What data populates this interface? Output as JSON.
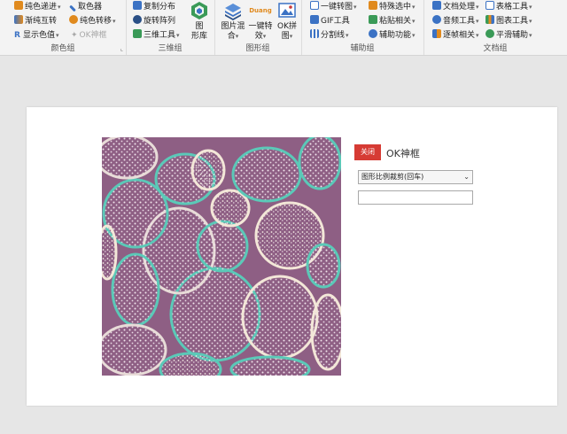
{
  "ribbon": {
    "groups": {
      "color": {
        "label": "颜色组",
        "items": [
          "纯色递进",
          "取色器",
          "渐纯互转",
          "纯色转移",
          "显示色值",
          "OK神框"
        ]
      },
      "three_d": {
        "label": "三维组",
        "items": [
          "复制分布",
          "旋转阵列",
          "三维工具"
        ],
        "big_label_1": "图",
        "big_label_2": "形库"
      },
      "graphics": {
        "label": "图形组",
        "btn1_l1": "图片混",
        "btn1_l2": "合",
        "btn2_top": "Duang",
        "btn2_l1": "一键特",
        "btn2_l2": "效",
        "btn3_l1": "OK拼",
        "btn3_l2": "图"
      },
      "assist": {
        "label": "辅助组",
        "items": [
          "一键转图",
          "特殊选中",
          "GIF工具",
          "粘贴相关",
          "分割线",
          "辅助功能"
        ]
      },
      "document": {
        "label": "文档组",
        "items": [
          "文档处理",
          "表格工具",
          "音频工具",
          "图表工具",
          "逐帧相关",
          "平滑辅助"
        ]
      }
    },
    "colors": {
      "blue": "#3b72c4",
      "orange": "#e08a1e",
      "green": "#3a9a57",
      "red": "#c83b3b",
      "purple": "#7a5bb5",
      "teal": "#2aa198"
    }
  },
  "panel": {
    "close_label": "关闭",
    "title": "OK神框",
    "crop_option": "图形比例裁剪(回车)",
    "input_value": ""
  },
  "artwork": {
    "background": "#8e5f84",
    "cell_colors": [
      "#5bc9b8",
      "#e8dcd8",
      "#f3e7d8"
    ]
  }
}
